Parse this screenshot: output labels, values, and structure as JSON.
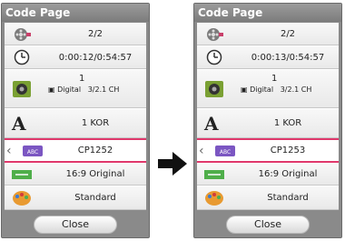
{
  "left": {
    "title": "Code Page",
    "rows": {
      "angle": "2/2",
      "time": "0:00:12/0:54:57",
      "audio_num": "1",
      "audio_codec": "Digital",
      "audio_ch": "3/2.1 CH",
      "subtitle": "1 KOR",
      "codepage": "CP1252",
      "aspect": "16:9 Original",
      "picture": "Standard"
    },
    "close_label": "Close"
  },
  "right": {
    "title": "Code Page",
    "rows": {
      "angle": "2/2",
      "time": "0:00:13/0:54:57",
      "audio_num": "1",
      "audio_codec": "Digital",
      "audio_ch": "3/2.1 CH",
      "subtitle": "1 KOR",
      "codepage": "CP1253",
      "aspect": "16:9 Original",
      "picture": "Standard"
    },
    "close_label": "Close"
  },
  "icons": {
    "angle": "film-reel-icon",
    "time": "clock-icon",
    "audio": "speaker-icon",
    "subtitle": "letter-a-icon",
    "codepage": "abc-icon",
    "aspect": "aspect-ratio-icon",
    "picture": "palette-icon",
    "chevron": "chevron-left-icon",
    "between": "arrow-right-icon"
  },
  "colors": {
    "selection": "#e0386c",
    "panel": "#8a8a8a"
  }
}
